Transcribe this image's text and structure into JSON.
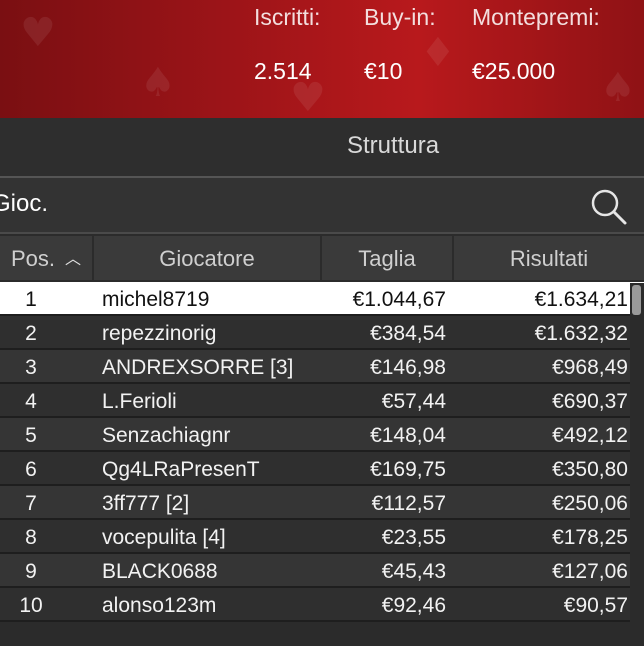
{
  "stats": {
    "entrants_label": "Iscritti:",
    "entrants_value": "2.514",
    "buyin_label": "Buy-in:",
    "buyin_value": "€10",
    "prize_label": "Montepremi:",
    "prize_value": "€25.000"
  },
  "tabs": {
    "active": "Struttura"
  },
  "search": {
    "value": "Gioc."
  },
  "table": {
    "headers": [
      "Pos.",
      "Giocatore",
      "Taglia",
      "Risultati"
    ],
    "sort_icon": "chevron-up",
    "rows": [
      {
        "pos": "1",
        "name": "michel8719",
        "size": "€1.044,67",
        "result": "€1.634,21"
      },
      {
        "pos": "2",
        "name": "repezzinorig",
        "size": "€384,54",
        "result": "€1.632,32"
      },
      {
        "pos": "3",
        "name": "ANDREXSORRE [3]",
        "size": "€146,98",
        "result": "€968,49"
      },
      {
        "pos": "4",
        "name": "L.Ferioli",
        "size": "€57,44",
        "result": "€690,37"
      },
      {
        "pos": "5",
        "name": "Senzachiagnr",
        "size": "€148,04",
        "result": "€492,12"
      },
      {
        "pos": "6",
        "name": "Qg4LRaPresenT",
        "size": "€169,75",
        "result": "€350,80"
      },
      {
        "pos": "7",
        "name": "3ff777 [2]",
        "size": "€112,57",
        "result": "€250,06"
      },
      {
        "pos": "8",
        "name": "vocepulita [4]",
        "size": "€23,55",
        "result": "€178,25"
      },
      {
        "pos": "9",
        "name": "BLACK0688",
        "size": "€45,43",
        "result": "€127,06"
      },
      {
        "pos": "10",
        "name": "alonso123m",
        "size": "€92,46",
        "result": "€90,57"
      }
    ]
  },
  "colors": {
    "banner": "#9c1418",
    "highlight_row": "#ffffff",
    "background": "#2b2b2b"
  }
}
